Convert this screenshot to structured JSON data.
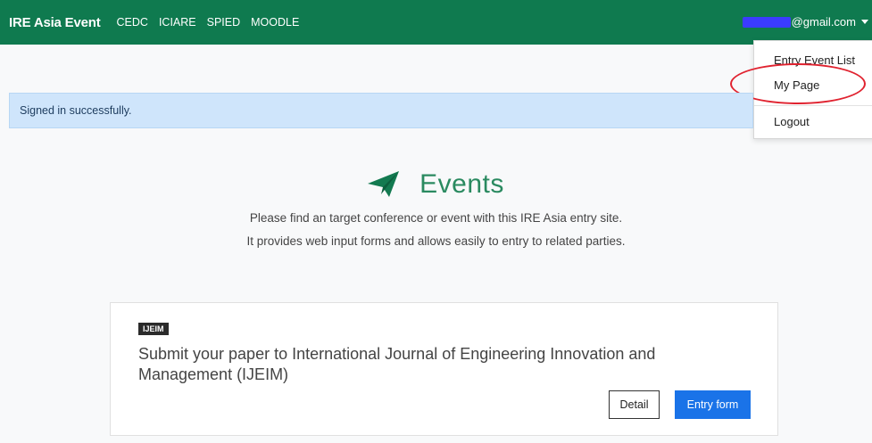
{
  "navbar": {
    "brand": "IRE Asia Event",
    "links": [
      "CEDC",
      "ICIARE",
      "SPIED",
      "MOODLE"
    ],
    "user_email_suffix": "@gmail.com"
  },
  "dropdown": {
    "items": [
      "Entry Event List",
      "My Page",
      "Logout"
    ]
  },
  "alert": {
    "message": "Signed in successfully."
  },
  "hero": {
    "title": "Events",
    "line1": "Please find an target conference or event with this IRE Asia entry site.",
    "line2": "It provides web input forms and allows easily to entry to related parties."
  },
  "card": {
    "tag": "IJEIM",
    "title": "Submit your paper to International Journal of Engineering Innovation and Management (IJEIM)",
    "detail_label": "Detail",
    "entry_label": "Entry form"
  },
  "colors": {
    "navbar": "#0f7a4f",
    "accent_green": "#2a8a60",
    "alert_bg": "#cfe5fb",
    "primary_button": "#1a73e8",
    "highlight": "#e0222f"
  }
}
